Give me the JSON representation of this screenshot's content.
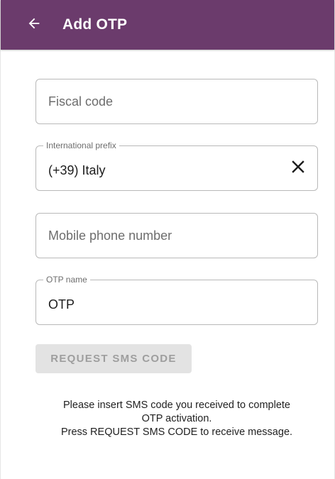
{
  "appbar": {
    "title": "Add OTP",
    "background": "#6b3b6c",
    "back_icon": "arrow-left-icon"
  },
  "form": {
    "fiscal_code": {
      "placeholder": "Fiscal code",
      "value": ""
    },
    "international_prefix": {
      "label": "International prefix",
      "value": "(+39) Italy",
      "clear_icon": "close-icon"
    },
    "mobile_phone": {
      "placeholder": "Mobile phone number",
      "value": ""
    },
    "otp_name": {
      "label": "OTP name",
      "value": "OTP"
    }
  },
  "actions": {
    "request_sms_label": "REQUEST SMS CODE",
    "request_sms_enabled": false
  },
  "info": {
    "line1": "Please insert SMS code you received to complete",
    "line2": "OTP activation.",
    "line3": "Press REQUEST SMS CODE to receive message."
  }
}
